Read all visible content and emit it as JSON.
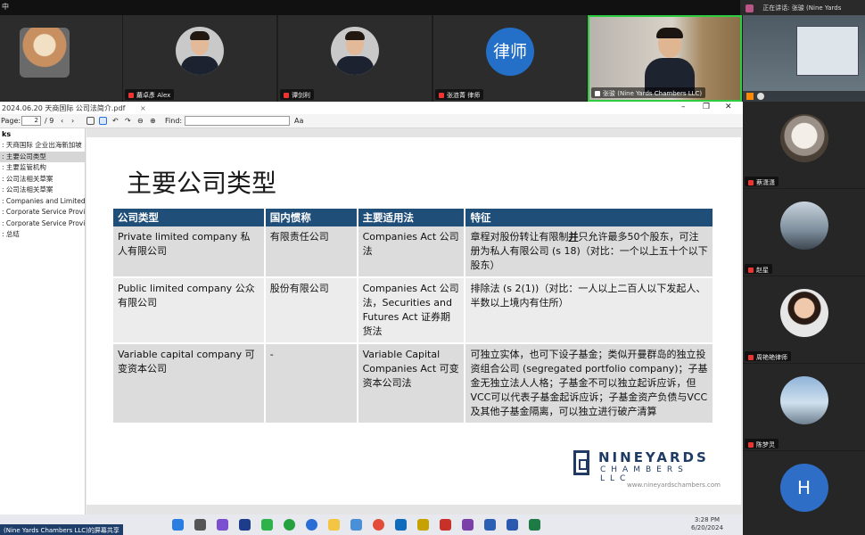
{
  "topbar": {
    "status": "中",
    "speaking_prefix": "正在讲话:",
    "speaking_name": "张骏 (Nine Yards"
  },
  "gallery": [
    {
      "name": ""
    },
    {
      "name": "蘿卓彥 Alex"
    },
    {
      "name": "谭剑利"
    },
    {
      "name": "张涟菁 律师",
      "avatar_text": "律师"
    },
    {
      "name": "张骏 (Nine Yards Chambers LLC)"
    }
  ],
  "participants": [
    {
      "name": "蔡潇潇"
    },
    {
      "name": "赵星"
    },
    {
      "name": "周艳艳律师"
    },
    {
      "name": "陈梦灵"
    },
    {
      "name": "hhh",
      "avatar_text": "H"
    }
  ],
  "pdf": {
    "title": "2024.06.20 天商国际 公司法简介.pdf",
    "close_tab": "×",
    "page_label": "Page:",
    "page_value": "2",
    "page_total": "/ 9",
    "find_label": "Find:",
    "sidebar_title": "ks",
    "sidebar_items": [
      ": 天商国际 企业出海新加坡",
      ": 主要公司类型",
      ": 主要监管机构",
      ": 公司法相关草案",
      ": 公司法相关草案",
      ": Companies and Limited L",
      ": Corporate Service Provide",
      ": Corporate Service Provide",
      ": 总结"
    ]
  },
  "slide": {
    "title": "主要公司类型",
    "headers": [
      "公司类型",
      "国内惯称",
      "主要适用法",
      "特征"
    ],
    "rows": [
      {
        "type": "Private limited company 私人有限公司",
        "common": "有限责任公司",
        "law": "Companies Act 公司法",
        "feature_pre": "章程对股份转让有限制",
        "feature_bold": "并",
        "feature_post": "只允许最多50个股东，可注册为私人有限公司 (s 18)（对比：一个以上五十个以下股东）"
      },
      {
        "type": "Public limited company 公众有限公司",
        "common": "股份有限公司",
        "law": "Companies Act 公司法，Securities and Futures Act 证券期货法",
        "feature_pre": "排除法 (s 2(1))（对比：一人以上二百人以下发起人、半数以上境内有住所）",
        "feature_bold": "",
        "feature_post": ""
      },
      {
        "type": "Variable capital company 可变资本公司",
        "common": "-",
        "law": "Variable Capital Companies Act 可变资本公司法",
        "feature_pre": "可独立实体，也可下设子基金；类似开曼群岛的独立投资组合公司 (segregated portfolio company)；子基金无独立法人人格；子基金不可以独立起诉应诉，但VCC可以代表子基金起诉应诉；子基金资产负债与VCC及其他子基金隔离，可以独立进行破产清算",
        "feature_bold": "",
        "feature_post": ""
      }
    ],
    "logo_line1": "NINEYARDS",
    "logo_line2": "CHAMBERS LLC",
    "logo_url": "www.nineyardschambers.com"
  },
  "taskbar": {
    "share_text": "(Nine Yards Chambers LLC)的屏幕共享",
    "time": "3:28 PM",
    "date": "6/20/2024"
  }
}
